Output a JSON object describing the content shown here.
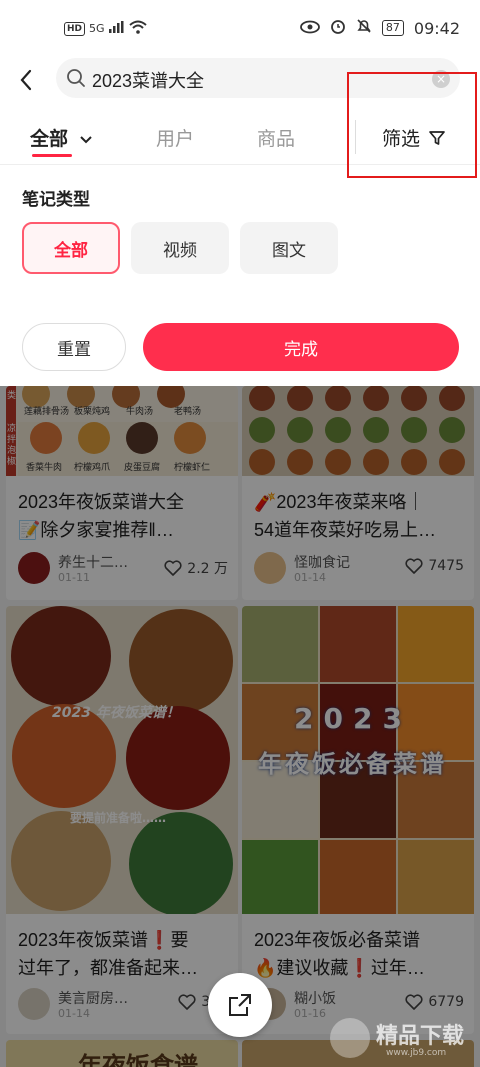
{
  "status_bar": {
    "hd": "HD",
    "signal": "5G",
    "battery": "87",
    "time": "09:42"
  },
  "search": {
    "query": "2023菜谱大全"
  },
  "tabs": [
    {
      "label": "全部",
      "active": true
    },
    {
      "label": "用户",
      "active": false
    },
    {
      "label": "商品",
      "active": false
    }
  ],
  "filter_label": "筛选",
  "filter_panel": {
    "section_title": "笔记类型",
    "note_types": [
      {
        "label": "全部",
        "active": true
      },
      {
        "label": "视频",
        "active": false
      },
      {
        "label": "图文",
        "active": false
      }
    ],
    "reset_label": "重置",
    "done_label": "完成"
  },
  "feed": {
    "cards": [
      {
        "title": "2023年夜饭菜谱大全📝除夕家宴推荐‖…",
        "title_lines": [
          "2023年夜饭菜谱大全",
          "📝除夕家宴推荐‖…"
        ],
        "author": "养生十二…",
        "date": "01-11",
        "likes": "2.2 万",
        "image_labels": [
          "类",
          "莲藕排骨汤",
          "板栗炖鸡",
          "牛肉汤",
          "老鸭汤",
          "凉拌泡椒",
          "香菜牛肉",
          "柠檬鸡爪",
          "皮蛋豆腐",
          "柠檬虾仁"
        ]
      },
      {
        "title": "🧨2023年夜菜来咯｜54道年夜菜好吃易上…",
        "title_lines": [
          "🧨2023年夜菜来咯｜",
          "54道年夜菜好吃易上…"
        ],
        "author": "怪咖食记",
        "date": "01-14",
        "likes": "7475"
      },
      {
        "title": "2023年夜饭菜谱❗要过年了，都准备起来…",
        "title_lines": [
          "2023年夜饭菜谱❗要",
          "过年了，都准备起来…"
        ],
        "author": "美言厨房…",
        "date": "01-14",
        "likes": "336",
        "image_labels": [
          "2023 年夜饭菜谱！",
          "要提前准备啦……"
        ]
      },
      {
        "title": "2023年夜饭必备菜谱🔥建议收藏❗过年…",
        "title_lines": [
          "2023年夜饭必备菜谱",
          "🔥建议收藏❗过年…"
        ],
        "author": "糊小饭",
        "date": "01-16",
        "likes": "6779",
        "image_labels": [
          "2023",
          "年夜饭必备菜谱"
        ]
      },
      {
        "title": "年夜饭食谱",
        "title_lines": [
          "年夜饭食谱"
        ]
      }
    ]
  },
  "watermark": {
    "text": "精品下载",
    "url": "www.jb9.com"
  },
  "colors": {
    "accent": "#ff2442",
    "highlight_box": "#e31b1b"
  }
}
